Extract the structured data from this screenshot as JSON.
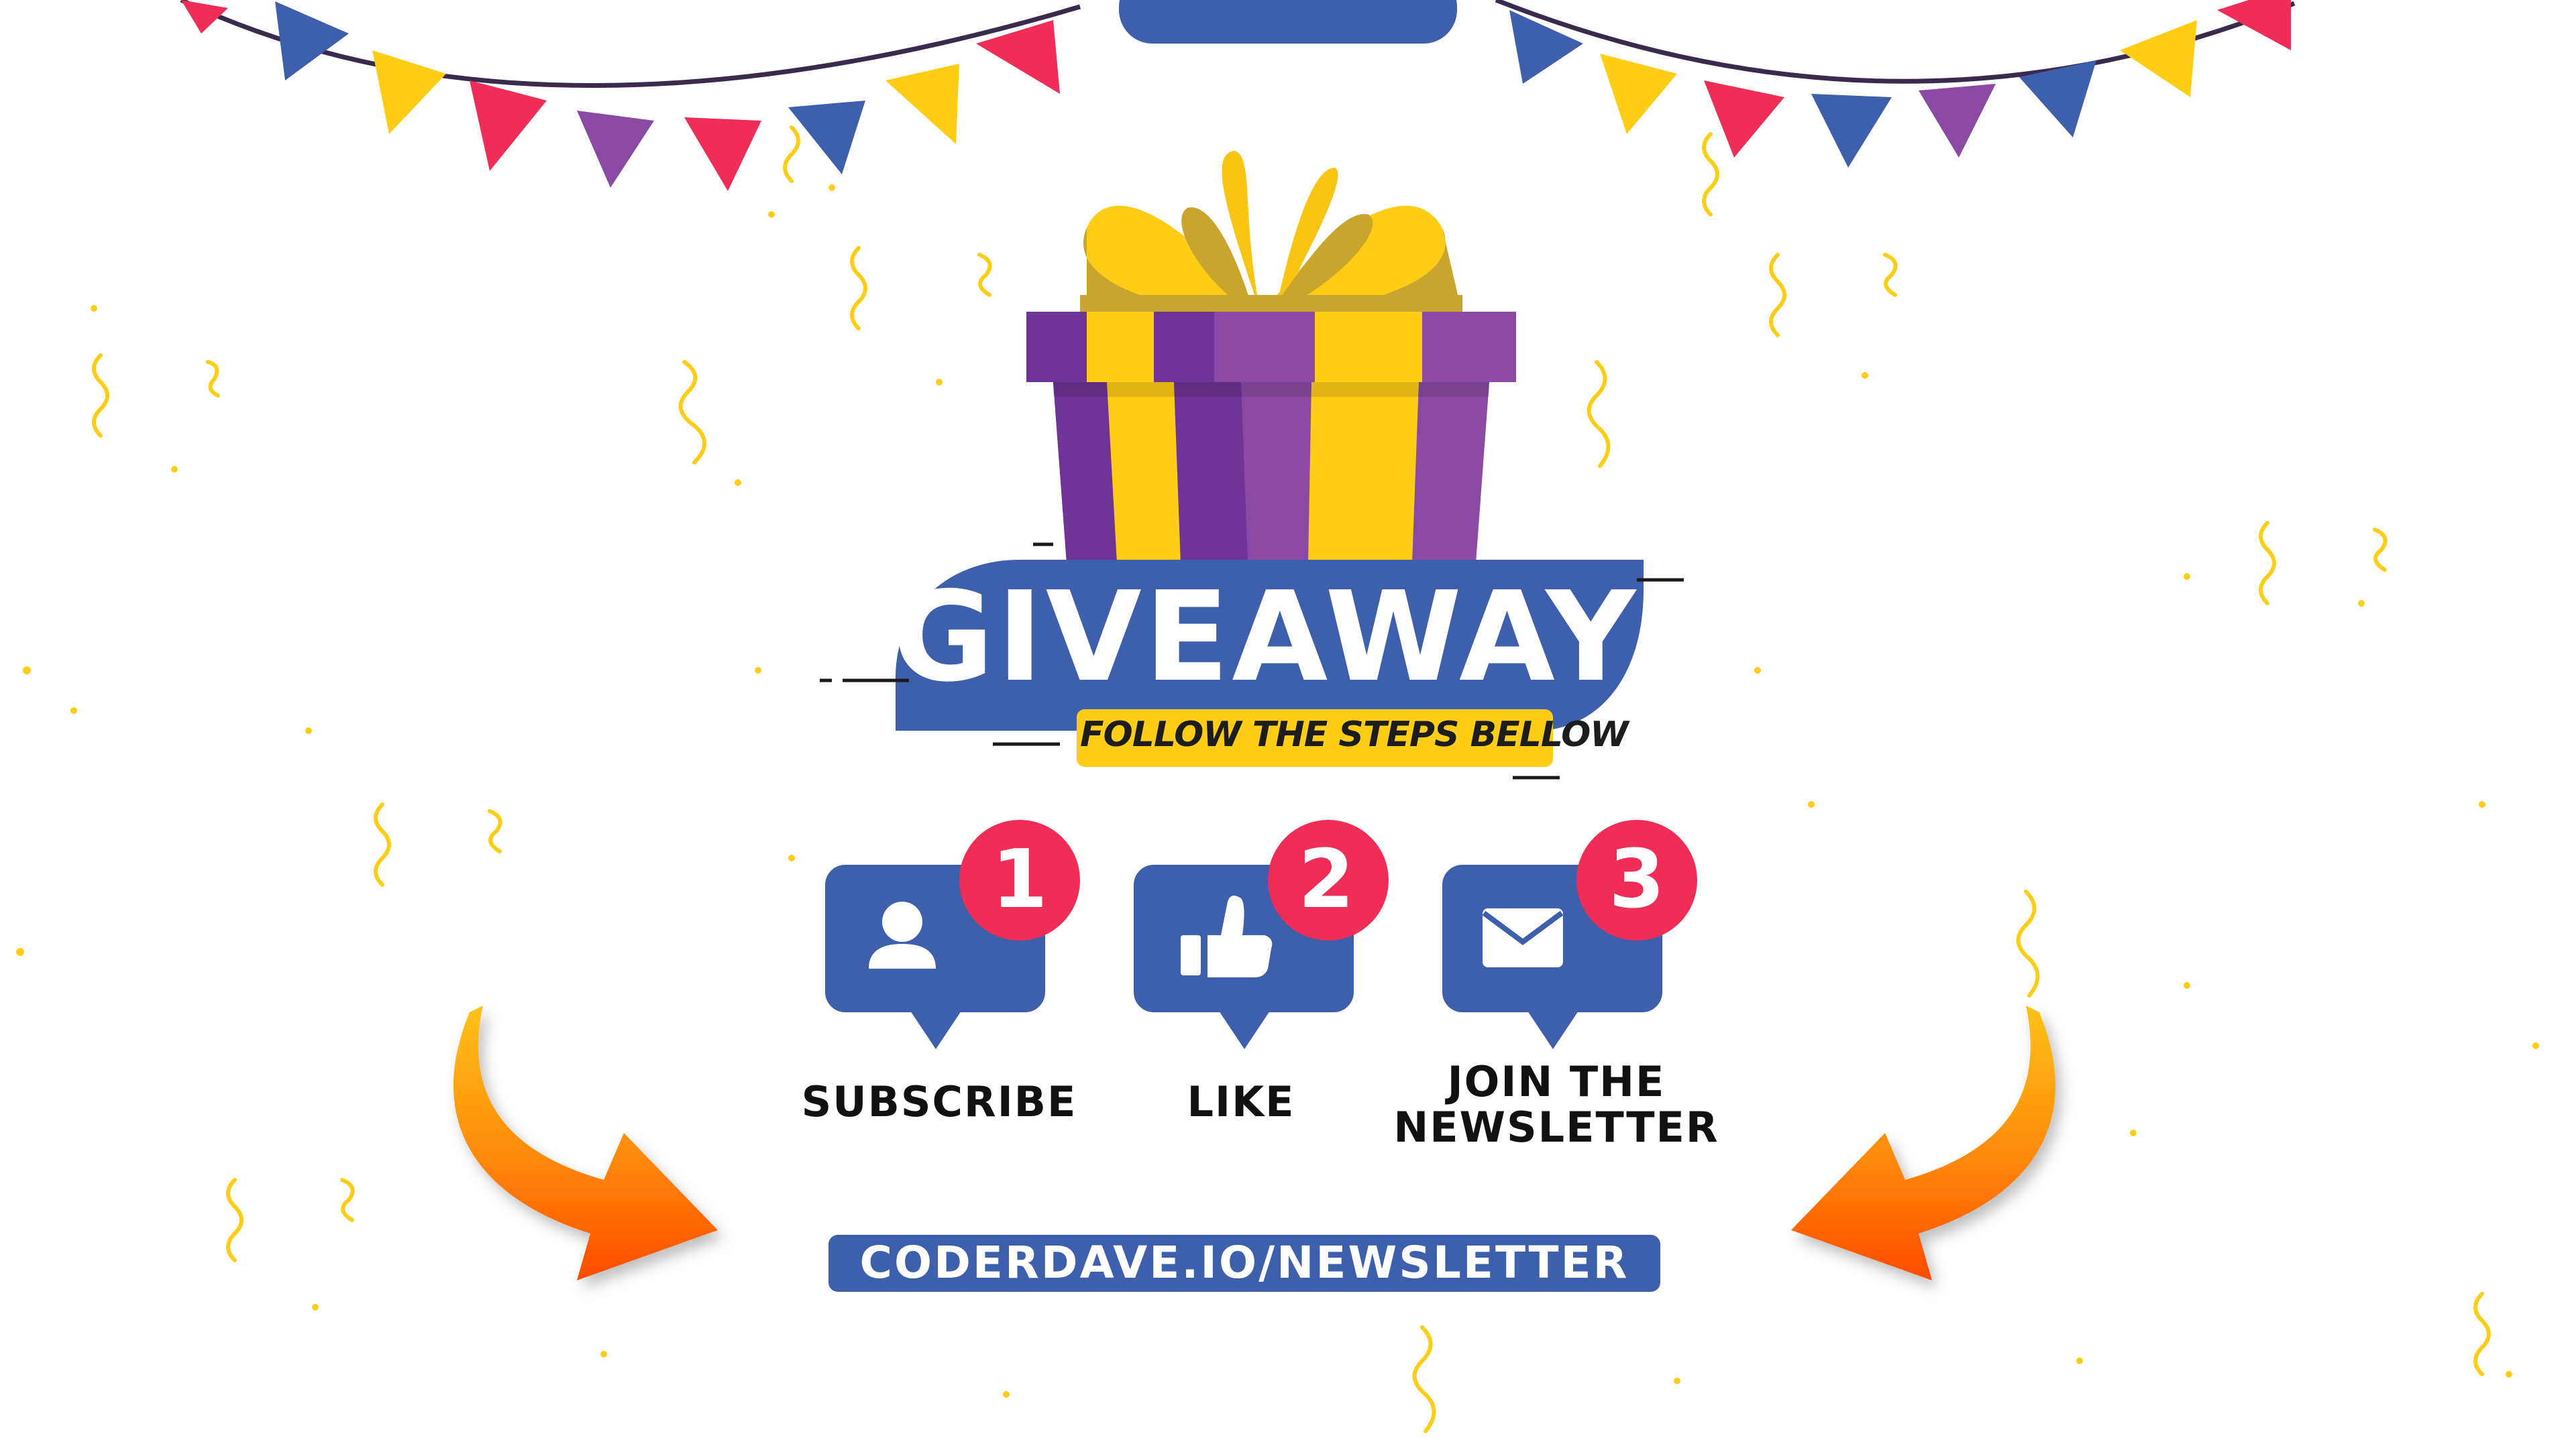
{
  "banner": {
    "title": "GIVEAWAY",
    "subtitle": "FOLLOW THE STEPS BELLOW"
  },
  "steps": [
    {
      "number": "1",
      "label": "SUBSCRIBE",
      "icon": "user-icon"
    },
    {
      "number": "2",
      "label": "LIKE",
      "icon": "thumbs-up-icon"
    },
    {
      "number": "3",
      "label": "JOIN THE NEWSLETTER",
      "icon": "envelope-icon"
    }
  ],
  "url": "CODERDAVE.IO/NEWSLETTER",
  "colors": {
    "blue": "#3d5fac",
    "red": "#ef2d56",
    "yellow": "#ffcd15",
    "purple": "#8a4aa3",
    "orange": "#ff5a00"
  }
}
